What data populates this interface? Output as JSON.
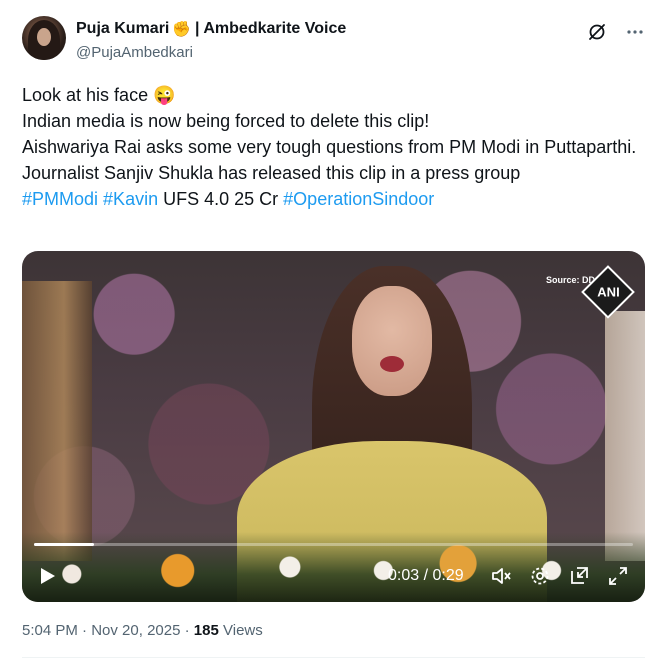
{
  "author": {
    "display_name": "Puja Kumari",
    "badge_icon": "raised-fist-icon",
    "name_suffix": "| Ambedkarite Voice",
    "handle": "@PujaAmbedkari"
  },
  "header_actions": {
    "grok_icon": "grok-icon",
    "more_icon": "more-horizontal-icon"
  },
  "tweet": {
    "line1_text": "Look at his face",
    "line1_emoji": "😜",
    "line2": "Indian media is now being forced to delete this clip!",
    "line3": "Aishwariya Rai asks some very tough questions from PM Modi in Puttaparthi.",
    "line4": "Journalist Sanjiv Shukla has released this clip in a press group",
    "hashtag1": "#PMModi",
    "hashtag2": "#Kavin",
    "plain_text": "UFS 4.0 25 Cr",
    "hashtag3": "#OperationSindoor"
  },
  "video": {
    "source_label": "Source: DD",
    "logo_text": "ANI",
    "current_time": "0:03",
    "duration": "0:29",
    "time_separator": "/",
    "progress_fraction": 0.1
  },
  "meta": {
    "time": "5:04 PM",
    "date": "Nov 20, 2025",
    "views_count": "185",
    "views_label": "Views",
    "separator": "·"
  },
  "colors": {
    "accent": "#1d9bf0",
    "secondary_text": "#536471",
    "primary_text": "#0f1419"
  }
}
